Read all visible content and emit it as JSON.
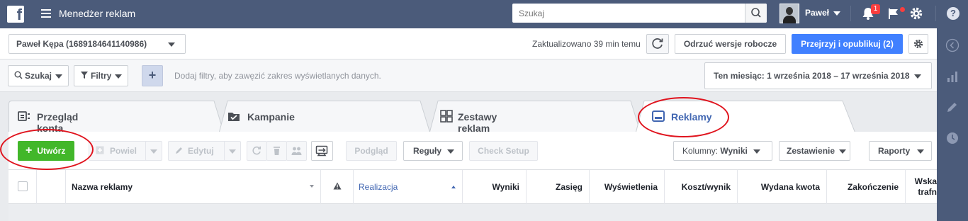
{
  "topbar": {
    "app_title": "Menedżer reklam",
    "search_placeholder": "Szukaj",
    "user_name": "Paweł",
    "notifications_count": "1",
    "help_label": "?"
  },
  "account_bar": {
    "account_name": "Paweł Kępa (1689184641140986)",
    "updated_text": "Zaktualizowano 39 min temu",
    "discard_label": "Odrzuć wersje robocze",
    "publish_label": "Przejrzyj i opublikuj (2)"
  },
  "filter_bar": {
    "search_label": "Szukaj",
    "filters_label": "Filtry",
    "add_label": "+",
    "hint": "Dodaj filtry, aby zawęzić zakres wyświetlanych danych.",
    "date_range": "Ten miesiąc: 1 września 2018 – 17 września 2018"
  },
  "tabs": [
    {
      "label": "Przegląd konta",
      "active": false
    },
    {
      "label": "Kampanie",
      "active": false
    },
    {
      "label": "Zestawy reklam",
      "active": false
    },
    {
      "label": "Reklamy",
      "active": true
    }
  ],
  "toolbar": {
    "create_label": "Utwórz",
    "duplicate_label": "Powiel",
    "edit_label": "Edytuj",
    "preview_label": "Podgląd",
    "rules_label": "Reguły",
    "check_setup_label": "Check Setup",
    "columns_prefix": "Kolumny:",
    "columns_value": "Wyniki",
    "breakdown_label": "Zestawienie",
    "reports_label": "Raporty"
  },
  "table": {
    "columns": [
      "Nazwa reklamy",
      "Realizacja",
      "Wyniki",
      "Zasięg",
      "Wyświetlenia",
      "Koszt/wynik",
      "Wydana kwota",
      "Zakończenie",
      "Wska",
      "trafn"
    ]
  },
  "colors": {
    "topbar": "#4b5b7a",
    "primary_blue": "#4080ff",
    "create_green": "#42b72a",
    "highlight_red": "#e0141e"
  }
}
